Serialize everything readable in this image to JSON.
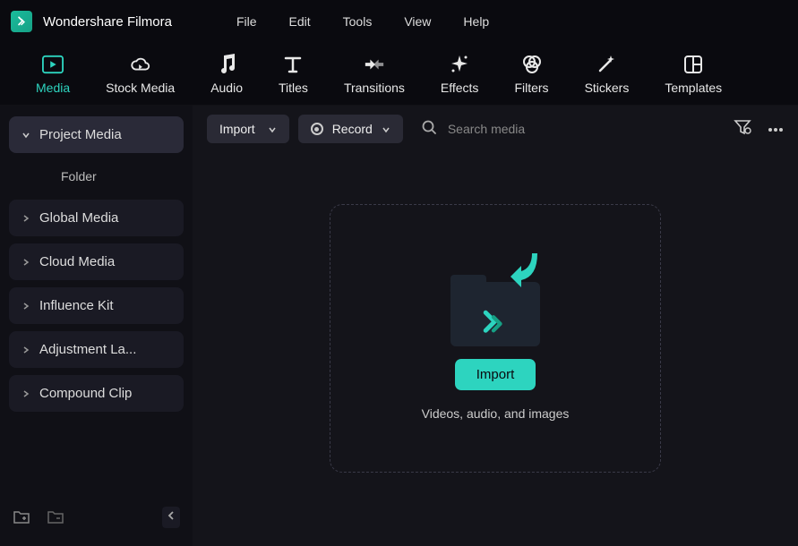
{
  "app": {
    "title": "Wondershare Filmora"
  },
  "menubar": [
    "File",
    "Edit",
    "Tools",
    "View",
    "Help"
  ],
  "tabs": [
    {
      "label": "Media",
      "active": true
    },
    {
      "label": "Stock Media"
    },
    {
      "label": "Audio"
    },
    {
      "label": "Titles"
    },
    {
      "label": "Transitions"
    },
    {
      "label": "Effects"
    },
    {
      "label": "Filters"
    },
    {
      "label": "Stickers"
    },
    {
      "label": "Templates"
    }
  ],
  "sidebar": {
    "items": [
      {
        "label": "Project Media",
        "active": true,
        "expanded": true
      },
      {
        "label": "Global Media"
      },
      {
        "label": "Cloud Media"
      },
      {
        "label": "Influence Kit"
      },
      {
        "label": "Adjustment La..."
      },
      {
        "label": "Compound Clip"
      }
    ],
    "sub": {
      "label": "Folder"
    }
  },
  "toolbar": {
    "import_label": "Import",
    "record_label": "Record",
    "search_placeholder": "Search media"
  },
  "dropzone": {
    "button": "Import",
    "caption": "Videos, audio, and images"
  }
}
